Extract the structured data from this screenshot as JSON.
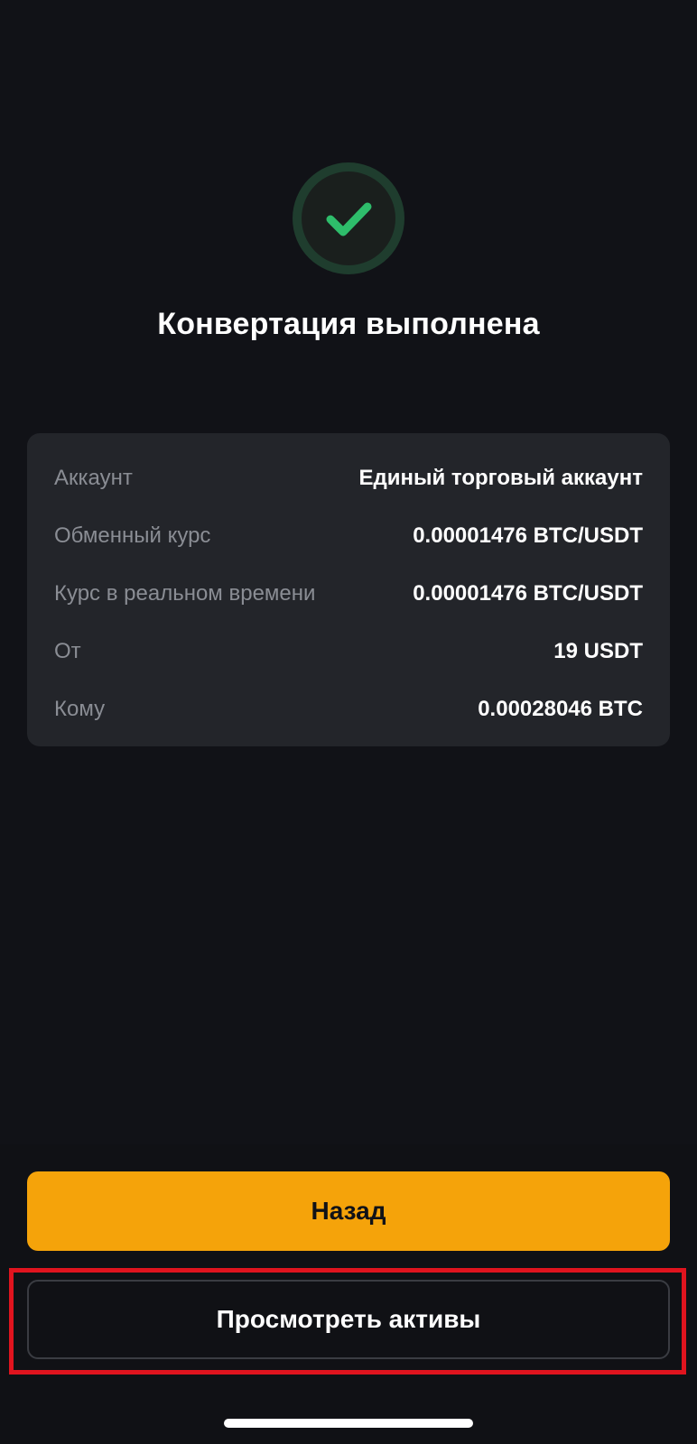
{
  "status": {
    "icon": "check-icon",
    "title": "Конвертация выполнена",
    "accent_color": "#2ebd6b"
  },
  "details": [
    {
      "label": "Аккаунт",
      "value": "Единый торговый аккаунт"
    },
    {
      "label": "Обменный курс",
      "value": "0.00001476 BTC/USDT"
    },
    {
      "label": "Курс в реальном времени",
      "value": "0.00001476 BTC/USDT"
    },
    {
      "label": "От",
      "value": "19 USDT"
    },
    {
      "label": "Кому",
      "value": "0.00028046 BTC"
    }
  ],
  "actions": {
    "back_label": "Назад",
    "back_color": "#f5a30a",
    "view_assets_label": "Просмотреть активы",
    "highlight_color": "#e0141e"
  }
}
